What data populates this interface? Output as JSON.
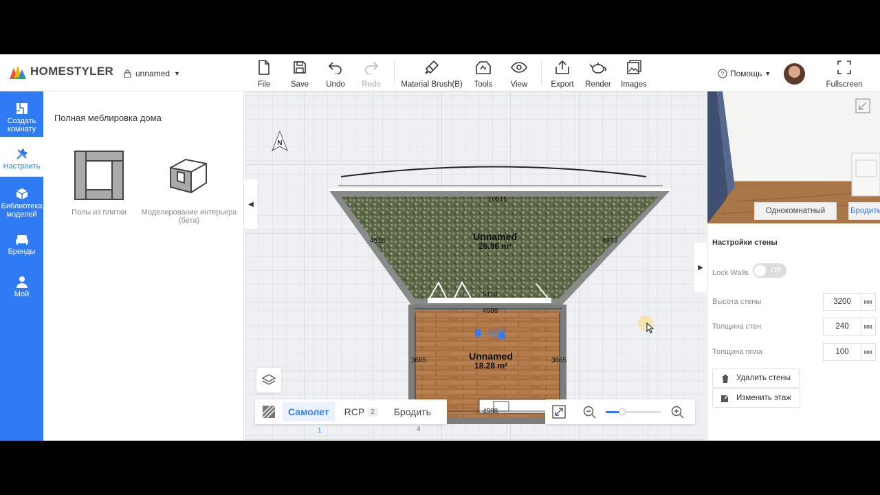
{
  "app": {
    "brand": "HOMESTYLER",
    "project_name": "unnamed"
  },
  "toolbar": {
    "file": "File",
    "save": "Save",
    "undo": "Undo",
    "redo": "Redo",
    "material_brush": "Material Brush(B)",
    "tools": "Tools",
    "view": "View",
    "export": "Export",
    "render": "Render",
    "images": "Images",
    "help": "Помощь",
    "fullscreen": "Fullscreen"
  },
  "sidebar": {
    "items": [
      {
        "label": "Создать комнату",
        "icon": "floorplan-icon"
      },
      {
        "label": "Настроить",
        "icon": "tools-icon",
        "active": true
      },
      {
        "label": "Библиотека моделей",
        "icon": "cube-icon"
      },
      {
        "label": "Бренды",
        "icon": "sofa-icon"
      },
      {
        "label": "Мой",
        "icon": "user-icon"
      }
    ]
  },
  "catalog": {
    "title": "Полная меблировка дома",
    "cards": [
      {
        "label": "Полы из плитки"
      },
      {
        "label": "Моделирование интерьера (бета)"
      }
    ]
  },
  "plan": {
    "compass": "N",
    "room1": {
      "name": "Unnamed",
      "area": "26.98 m²"
    },
    "room2": {
      "name": "Unnamed",
      "area": "18.28 m²"
    },
    "dims": {
      "top": "10515",
      "left_slant": "4518",
      "right_slant": "4873",
      "door": "5110",
      "mid": "4988",
      "left": "3665",
      "right": "3665",
      "bottom": "4988"
    }
  },
  "modebar": {
    "plane": "Самолет",
    "plane_key": "1",
    "rcp": "RCP",
    "rcp_key": "2",
    "walk": "Бродить",
    "walk_key": "4"
  },
  "zoom": {
    "level": 0.3
  },
  "preview": {
    "room_type": "Однокомнатный",
    "walk": "Бродить"
  },
  "wall_settings": {
    "title": "Настройки стены",
    "lock_walls_label": "Lock Walls",
    "lock_walls_state": "Off",
    "height_label": "Высота стены",
    "height_value": "3200",
    "thickness_label": "Толщина стен",
    "thickness_value": "240",
    "floor_label": "Толщина пола",
    "floor_value": "100",
    "unit": "мм",
    "delete_walls": "Удалить стены",
    "change_floor": "Изменить этаж"
  },
  "colors": {
    "accent": "#2f7bf5",
    "wall": "#7d7d7d",
    "floor_wood": "#b07a4c",
    "floor_grass": "#5f6b4a"
  }
}
